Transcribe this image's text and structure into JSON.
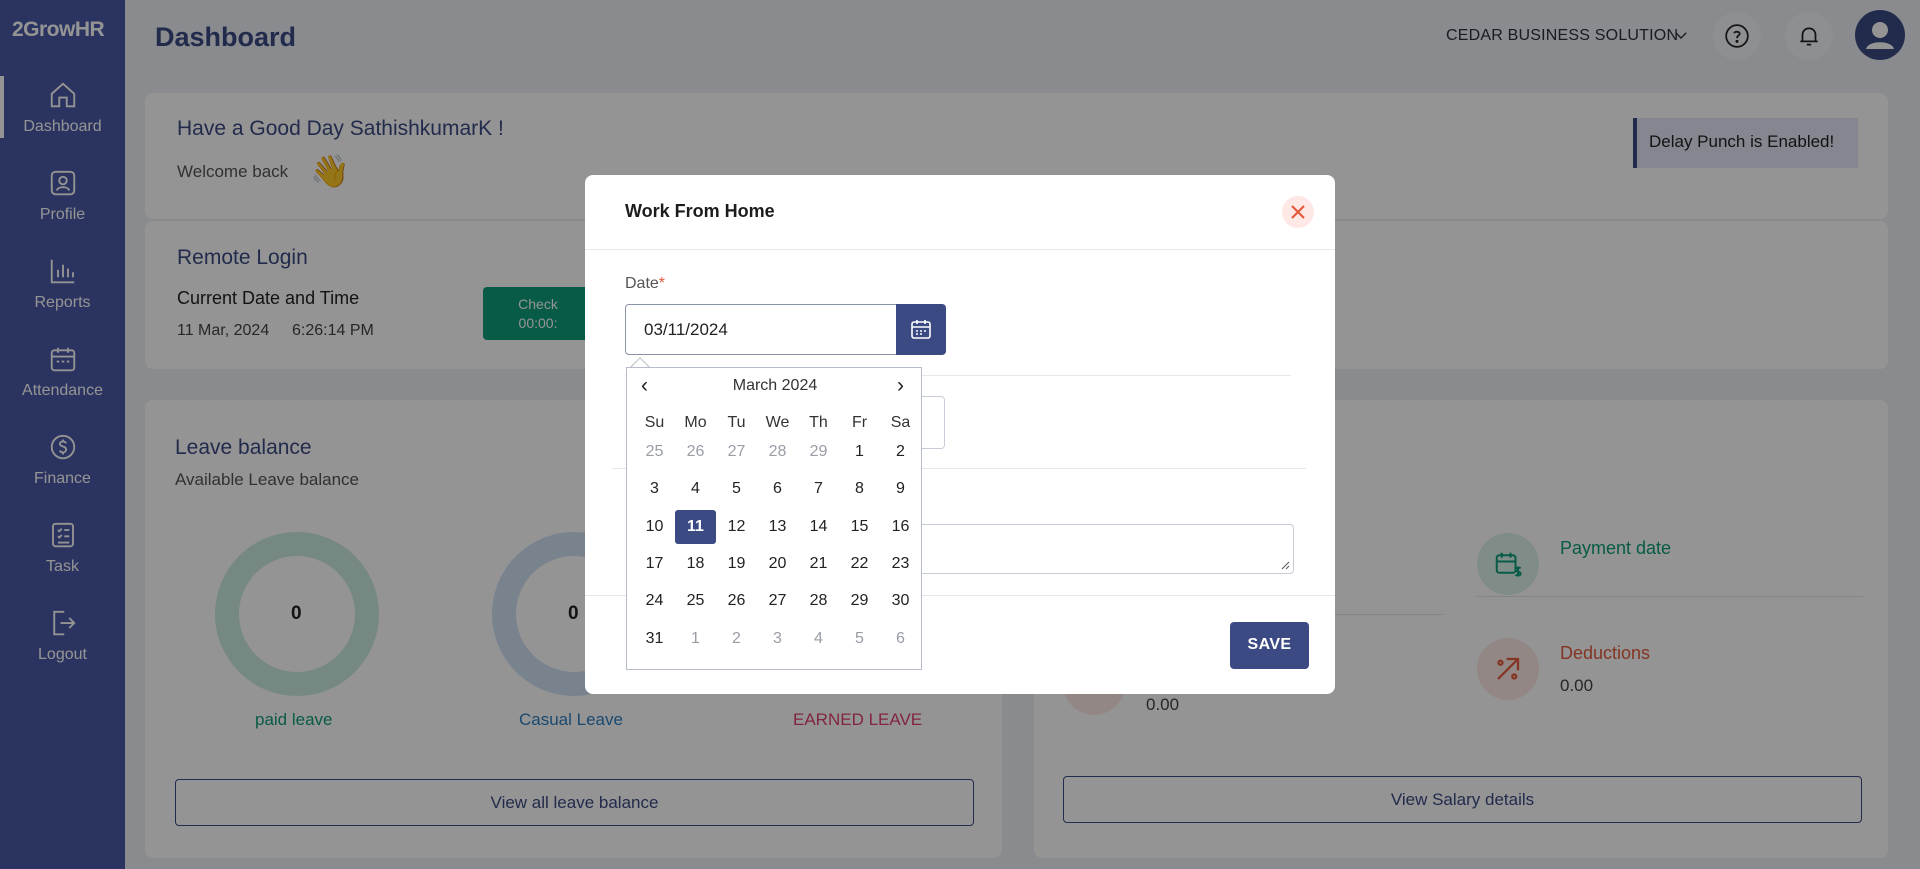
{
  "app": {
    "logo": "2GrowHR"
  },
  "colors": {
    "brand": "#3c4a84",
    "sidebar": "#4a5ba6",
    "accent_green": "#0f9d7a",
    "accent_red": "#e45a3c"
  },
  "sidebar": {
    "items": [
      {
        "label": "Dashboard",
        "icon": "home-icon",
        "active": true
      },
      {
        "label": "Profile",
        "icon": "user-icon"
      },
      {
        "label": "Reports",
        "icon": "bar-chart-icon"
      },
      {
        "label": "Attendance",
        "icon": "calendar-icon"
      },
      {
        "label": "Finance",
        "icon": "finance-icon"
      },
      {
        "label": "Task",
        "icon": "task-list-icon"
      },
      {
        "label": "Logout",
        "icon": "logout-icon"
      }
    ]
  },
  "header": {
    "title": "Dashboard",
    "company": "CEDAR BUSINESS SOLUTION"
  },
  "greeting": {
    "title": "Have a Good Day SathishkumarK !",
    "subtitle": "Welcome back",
    "emoji": "👋",
    "delay_punch": "Delay Punch is Enabled!"
  },
  "remote_login": {
    "title": "Remote Login",
    "datetime_label": "Current Date and Time",
    "date": "11 Mar, 2024",
    "time": "6:26:14 PM",
    "check_label": "Check",
    "check_timer": "00:00:"
  },
  "leave_balance": {
    "title": "Leave balance",
    "subtitle": "Available Leave balance",
    "items": [
      {
        "name": "paid leave",
        "value": "0"
      },
      {
        "name": "Casual Leave",
        "value": "0"
      },
      {
        "name": "EARNED LEAVE",
        "value": ""
      }
    ],
    "view_all": "View all leave balance"
  },
  "salary": {
    "payment_date_label": "Payment date",
    "deductions_label": "Deductions",
    "deductions_value": "0.00",
    "other_value": "0.00",
    "view": "View Salary details"
  },
  "modal": {
    "title": "Work From Home",
    "date_label": "Date",
    "required_mark": "*",
    "date_value": "03/11/2024",
    "save_label": "SAVE"
  },
  "datepicker": {
    "prev": "‹",
    "next": "›",
    "month": "March 2024",
    "weekdays": [
      "Su",
      "Mo",
      "Tu",
      "We",
      "Th",
      "Fr",
      "Sa"
    ],
    "weeks": [
      [
        "25",
        "26",
        "27",
        "28",
        "29",
        "1",
        "2"
      ],
      [
        "3",
        "4",
        "5",
        "6",
        "7",
        "8",
        "9"
      ],
      [
        "10",
        "11",
        "12",
        "13",
        "14",
        "15",
        "16"
      ],
      [
        "17",
        "18",
        "19",
        "20",
        "21",
        "22",
        "23"
      ],
      [
        "24",
        "25",
        "26",
        "27",
        "28",
        "29",
        "30"
      ],
      [
        "31",
        "1",
        "2",
        "3",
        "4",
        "5",
        "6"
      ]
    ],
    "selected": "11"
  }
}
